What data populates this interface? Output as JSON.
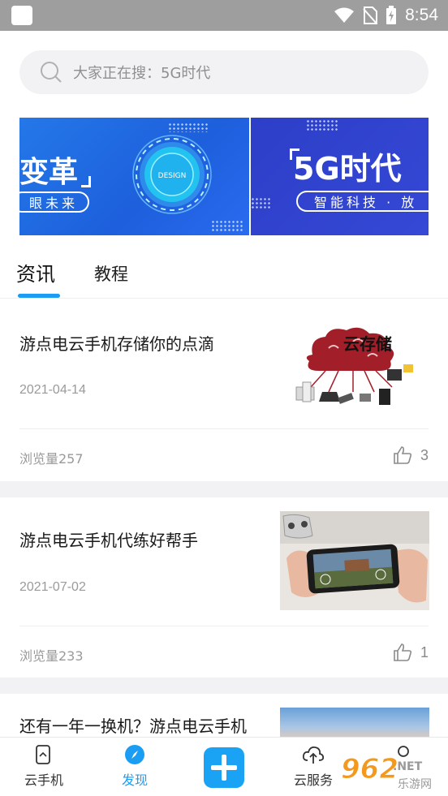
{
  "status_bar": {
    "time": "8:54"
  },
  "search": {
    "placeholder": "大家正在搜：5G时代"
  },
  "banner": {
    "slides": [
      {
        "title": "变革",
        "subtitle": "眼未来",
        "badge": "DESIGN"
      },
      {
        "title": "5G时代",
        "subtitle": "智能科技 · 放"
      }
    ]
  },
  "tabs": [
    {
      "label": "资讯",
      "active": true
    },
    {
      "label": "教程",
      "active": false
    }
  ],
  "articles": [
    {
      "title": "游点电云手机存储你的点滴",
      "date": "2021-04-14",
      "views": "浏览量257",
      "likes": "3",
      "image_caption": "云存储"
    },
    {
      "title": "游点电云手机代练好帮手",
      "date": "2021-07-02",
      "views": "浏览量233",
      "likes": "1"
    },
    {
      "title": "还有一年一换机？游点电云手机"
    }
  ],
  "bottom_nav": {
    "items": [
      {
        "label": "云手机",
        "active": false
      },
      {
        "label": "发现",
        "active": true
      },
      {
        "label": "云服务",
        "active": false
      }
    ]
  },
  "watermark": {
    "number": "962",
    "net": ".NET",
    "site": "乐游网"
  },
  "colors": {
    "accent": "#1a9df3",
    "banner_blue": "#1d5fdc",
    "separator": "#f2f2f4"
  }
}
